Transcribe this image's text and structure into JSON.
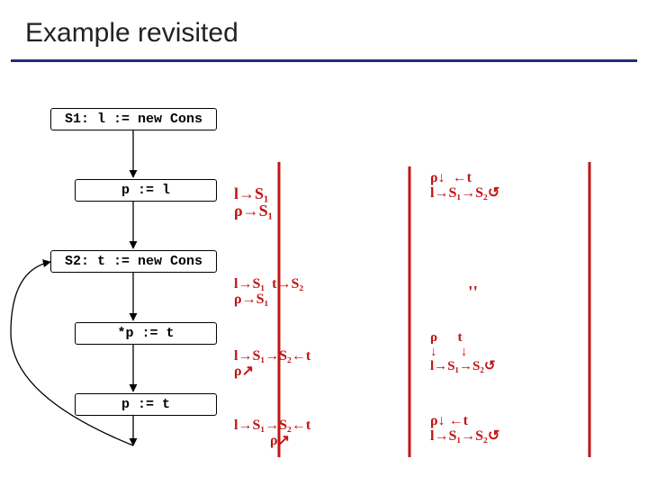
{
  "title": "Example revisited",
  "boxes": [
    {
      "label": "S1: l := new Cons"
    },
    {
      "label": "p := l"
    },
    {
      "label": "S2: t := new Cons"
    },
    {
      "label": "*p := t"
    },
    {
      "label": "p := t"
    }
  ],
  "annotations": {
    "col1": {
      "r1": "l→S₁\nρ→S₁",
      "r2": "l→S₁  t→S₂\nρ→S₁",
      "r3": "l→S₁→S₂←t\nρ↗",
      "r4": "l→S₁→S₂←t\n          ρ↗"
    },
    "col2": {
      "r0": "ρ↓  ←t\nl→S₁→S₂↺",
      "r2": "''",
      "r3": "ρ      t\n↓       ↓\nl→S₁→S₂↺",
      "r4": "ρ↓ ←t\nl→S₁→S₂↺"
    }
  },
  "colors": {
    "rule": "#29297a",
    "ink": "#c21414"
  }
}
